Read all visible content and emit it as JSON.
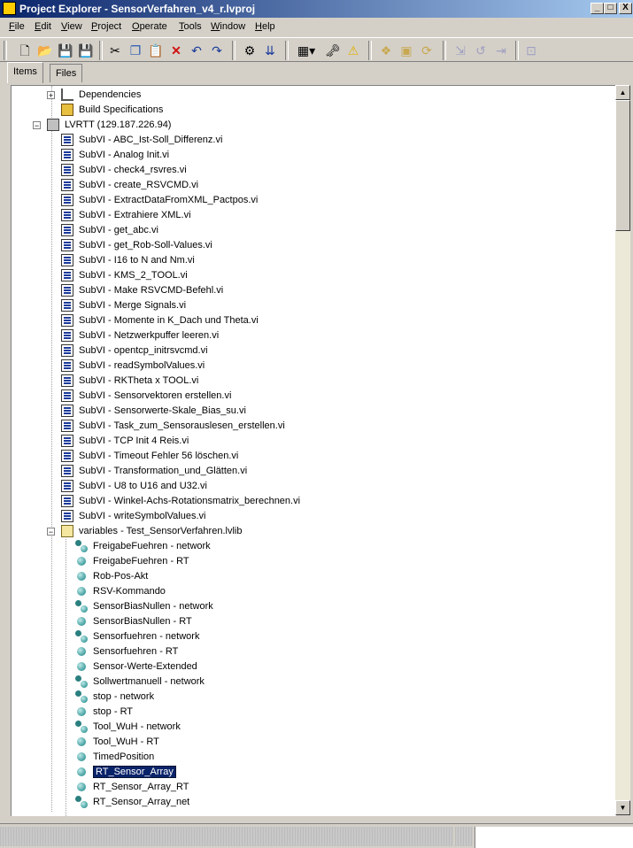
{
  "window": {
    "title": "Project Explorer - SensorVerfahren_v4_r.lvproj",
    "minimize": "_",
    "maximize": "□",
    "close": "X"
  },
  "menu": [
    {
      "label": "File",
      "u": "F",
      "rest": "ile"
    },
    {
      "label": "Edit",
      "u": "E",
      "rest": "dit"
    },
    {
      "label": "View",
      "u": "V",
      "rest": "iew"
    },
    {
      "label": "Project",
      "u": "P",
      "rest": "roject"
    },
    {
      "label": "Operate",
      "u": "O",
      "rest": "perate"
    },
    {
      "label": "Tools",
      "u": "T",
      "rest": "ools"
    },
    {
      "label": "Window",
      "u": "W",
      "rest": "indow"
    },
    {
      "label": "Help",
      "u": "H",
      "rest": "elp"
    }
  ],
  "toolbar_icons": [
    "new-icon",
    "open-icon",
    "save-icon",
    "save-all-icon",
    "cut-icon",
    "copy-icon",
    "paste-icon",
    "delete-icon",
    "undo-icon",
    "redo-icon",
    "build-icon",
    "deploy-icon",
    "view-options-icon",
    "properties-icon",
    "warning-icon",
    "files-icon",
    "folder-icon",
    "refresh-icon",
    "disabled-1-icon",
    "disabled-2-icon",
    "disabled-3-icon",
    "disabled-4-icon"
  ],
  "tabs": [
    {
      "label": "Items",
      "active": true
    },
    {
      "label": "Files",
      "active": false
    }
  ],
  "tree": {
    "top_items": [
      {
        "label": "Dependencies",
        "icon": "dependencies-icon"
      },
      {
        "label": "Build Specifications",
        "icon": "build-icon"
      }
    ],
    "target": {
      "label": "LVRTT (129.187.226.94)",
      "icon": "target-icon"
    },
    "subvis": [
      "SubVI - ABC_Ist-Soll_Differenz.vi",
      "SubVI - Analog Init.vi",
      "SubVI - check4_rsvres.vi",
      "SubVI - create_RSVCMD.vi",
      "SubVI - ExtractDataFromXML_Pactpos.vi",
      "SubVI - Extrahiere XML.vi",
      "SubVI - get_abc.vi",
      "SubVI - get_Rob-Soll-Values.vi",
      "SubVI - I16 to N and Nm.vi",
      "SubVI - KMS_2_TOOL.vi",
      "SubVI - Make RSVCMD-Befehl.vi",
      "SubVI - Merge Signals.vi",
      "SubVI - Momente in K_Dach und Theta.vi",
      "SubVI - Netzwerkpuffer leeren.vi",
      "SubVI - opentcp_initrsvcmd.vi",
      "SubVI - readSymbolValues.vi",
      "SubVI - RKTheta x TOOL.vi",
      "SubVI - Sensorvektoren erstellen.vi",
      "SubVI - Sensorwerte-Skale_Bias_su.vi",
      "SubVI - Task_zum_Sensorauslesen_erstellen.vi",
      "SubVI - TCP Init 4 Reis.vi",
      "SubVI - Timeout Fehler 56 löschen.vi",
      "SubVI - Transformation_und_Glätten.vi",
      "SubVI - U8 to U16 and U32.vi",
      "SubVI - Winkel-Achs-Rotationsmatrix_berechnen.vi",
      "SubVI - writeSymbolValues.vi"
    ],
    "library": {
      "label": "variables - Test_SensorVerfahren.lvlib",
      "icon": "library-icon"
    },
    "variables": [
      {
        "label": "FreigabeFuehren - network",
        "icon": "network-variable-icon"
      },
      {
        "label": "FreigabeFuehren - RT",
        "icon": "variable-icon"
      },
      {
        "label": "Rob-Pos-Akt",
        "icon": "variable-icon"
      },
      {
        "label": "RSV-Kommando",
        "icon": "variable-icon"
      },
      {
        "label": "SensorBiasNullen - network",
        "icon": "network-variable-icon"
      },
      {
        "label": "SensorBiasNullen - RT",
        "icon": "variable-icon"
      },
      {
        "label": "Sensorfuehren - network",
        "icon": "network-variable-icon"
      },
      {
        "label": "Sensorfuehren - RT",
        "icon": "variable-icon"
      },
      {
        "label": "Sensor-Werte-Extended",
        "icon": "variable-icon"
      },
      {
        "label": "Sollwertmanuell - network",
        "icon": "network-variable-icon"
      },
      {
        "label": "stop - network",
        "icon": "network-variable-icon"
      },
      {
        "label": "stop - RT",
        "icon": "variable-icon"
      },
      {
        "label": "Tool_WuH - network",
        "icon": "network-variable-icon"
      },
      {
        "label": "Tool_WuH - RT",
        "icon": "variable-icon"
      },
      {
        "label": "TimedPosition",
        "icon": "variable-icon"
      },
      {
        "label": "RT_Sensor_Array",
        "icon": "array-variable-icon",
        "selected": true
      },
      {
        "label": "RT_Sensor_Array_RT",
        "icon": "variable-icon"
      },
      {
        "label": "RT_Sensor_Array_net",
        "icon": "network-array-variable-icon"
      }
    ]
  },
  "expanders": {
    "collapsed": "+",
    "expanded": "−"
  },
  "scroll": {
    "up": "▲",
    "down": "▼"
  }
}
